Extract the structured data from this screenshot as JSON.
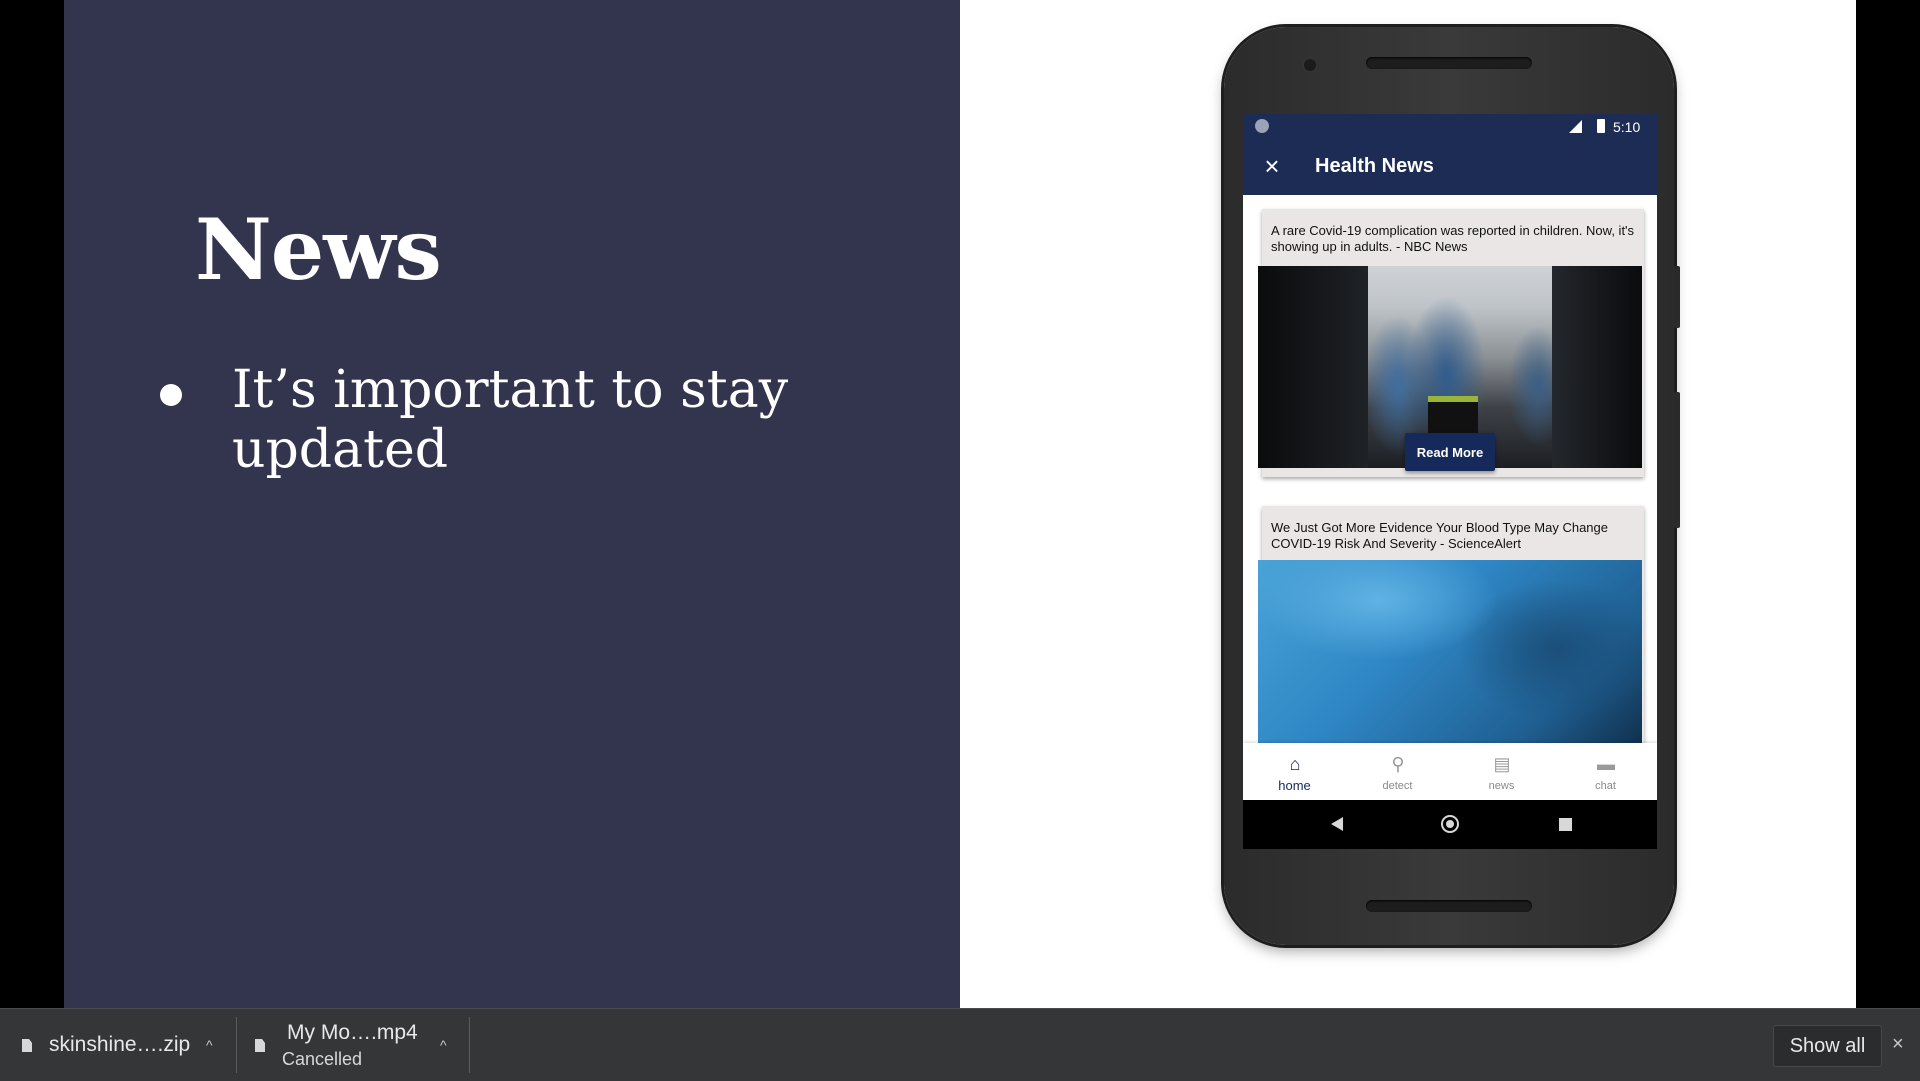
{
  "slide": {
    "title": "News",
    "bullet": "It’s important to stay updated"
  },
  "phone": {
    "status_time": "5:10",
    "app_title": "Health News",
    "close_icon": "×",
    "articles": [
      {
        "title": "A rare Covid-19 complication was reported in children. Now, it's showing up in adults. - NBC News",
        "button": "Read More"
      },
      {
        "title": "We Just Got More Evidence Your Blood Type May Change COVID-19 Risk And Severity - ScienceAlert"
      }
    ],
    "bottom_nav": [
      {
        "label": "home",
        "icon": "home-icon",
        "active": true
      },
      {
        "label": "detect",
        "icon": "search-icon",
        "active": false
      },
      {
        "label": "news",
        "icon": "news-icon",
        "active": false
      },
      {
        "label": "chat",
        "icon": "chat-icon",
        "active": false
      }
    ]
  },
  "downloads": {
    "items": [
      {
        "name": "skinshine….zip",
        "status": ""
      },
      {
        "name": "My Mo….mp4",
        "status": "Cancelled"
      }
    ],
    "show_all": "Show all",
    "close": "×"
  },
  "colors": {
    "slide_left_bg": "#33344e",
    "app_bar": "#1c2c55",
    "button": "#152a5a",
    "card_bg": "#ebe6e6",
    "download_bar": "#353637"
  }
}
